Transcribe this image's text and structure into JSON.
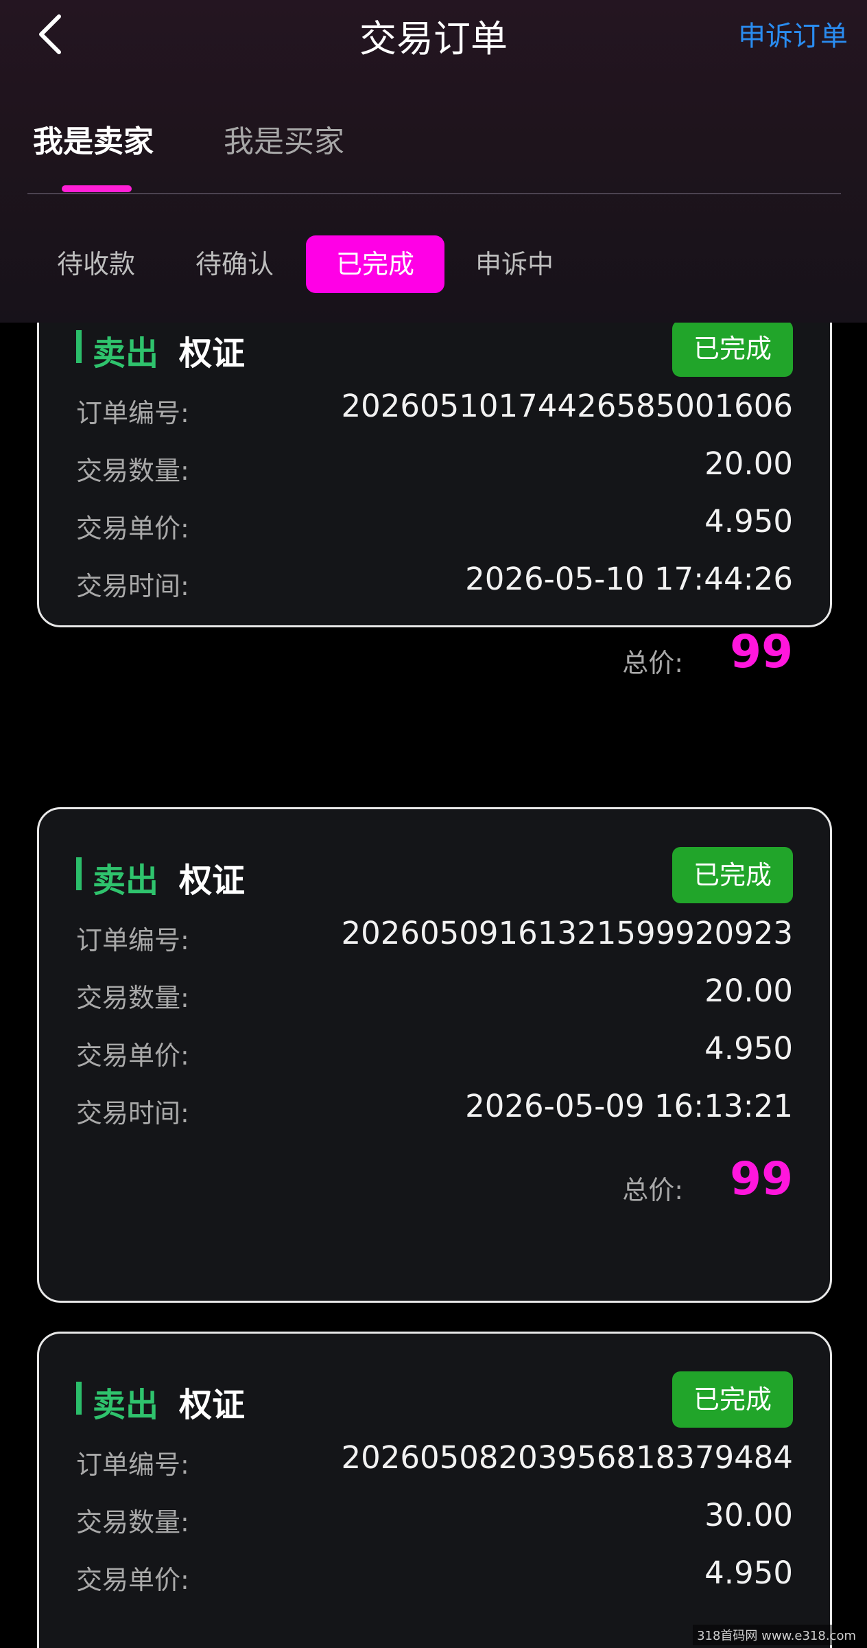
{
  "nav": {
    "title": "交易订单",
    "appeal_link": "申诉订单"
  },
  "role_tabs": {
    "seller": "我是卖家",
    "buyer": "我是买家"
  },
  "status_tabs": [
    "待收款",
    "待确认",
    "已完成",
    "申诉中"
  ],
  "labels": {
    "order_no": "订单编号:",
    "qty": "交易数量:",
    "price": "交易单价:",
    "time": "交易时间:",
    "total": "总价:"
  },
  "orders": [
    {
      "type": "卖出",
      "asset": "权证",
      "status": "已完成",
      "order_no": "2026051017442658500160​6",
      "qty": "20.00",
      "price": "4.950",
      "time": "2026-05-10 17:44:26",
      "total": "99"
    },
    {
      "type": "卖出",
      "asset": "权证",
      "status": "已完成",
      "order_no": "202605091613215999209​23",
      "qty": "20.00",
      "price": "4.950",
      "time": "2026-05-09 16:13:21",
      "total": "99"
    },
    {
      "type": "卖出",
      "asset": "权证",
      "status": "已完成",
      "order_no": "20260508203956818379484",
      "qty": "30.00",
      "price": "4.950"
    }
  ],
  "watermark": "318首码网 www.e318.com",
  "colors": {
    "accent": "#ff00e6",
    "success": "#21a52a",
    "sell": "#2fc36d",
    "link": "#2a8cf0"
  }
}
